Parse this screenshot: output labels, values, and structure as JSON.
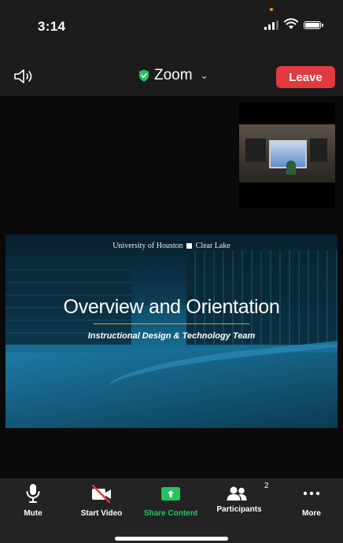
{
  "status_bar": {
    "time": "3:14"
  },
  "header": {
    "meeting_app": "Zoom",
    "leave_label": "Leave"
  },
  "slide": {
    "brand_left": "University of Houston",
    "brand_right": "Clear Lake",
    "title": "Overview and Orientation",
    "subtitle": "Instructional Design & Technology Team"
  },
  "toolbar": {
    "mute_label": "Mute",
    "start_video_label": "Start Video",
    "share_content_label": "Share Content",
    "participants_label": "Participants",
    "participants_count": "2",
    "more_label": "More"
  },
  "colors": {
    "leave_button": "#e0393e",
    "share_accent": "#22c55e",
    "shield": "#22c55e",
    "video_off_slash": "#e0393e"
  },
  "icons": [
    "speaker-icon",
    "shield-icon",
    "microphone-icon",
    "video-off-icon",
    "share-screen-icon",
    "participants-icon",
    "more-icon"
  ]
}
